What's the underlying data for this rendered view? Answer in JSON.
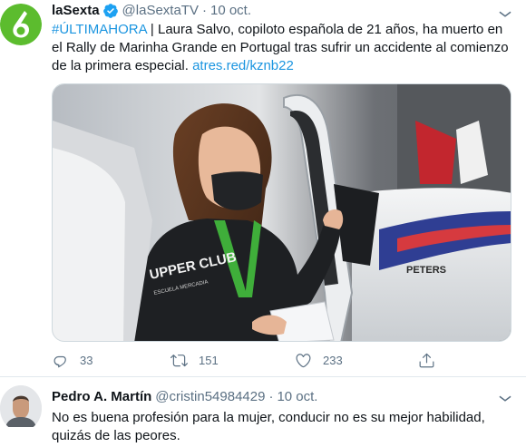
{
  "main_tweet": {
    "author_name": "laSexta",
    "author_handle": "@laSextaTV",
    "separator": "·",
    "date": "10 oct.",
    "hashtag": "#ÚLTIMAHORA",
    "body": " | Laura Salvo, copiloto española de 21 años, ha muerto en el Rally de Marinha Grande en Portugal tras sufrir un accidente al comienzo de la primera especial. ",
    "link": "atres.red/kznb22",
    "media": {
      "car_lettering": "PETERS",
      "sticker_text": "UPPER CLUB",
      "sticker_subtext": "ESCUELA MERCADIA"
    },
    "actions": {
      "replies": "33",
      "retweets": "151",
      "likes": "233"
    }
  },
  "reply_tweet": {
    "author_name": "Pedro A. Martín",
    "author_handle": "@cristin54984429",
    "separator": "·",
    "date": "10 oct.",
    "body": "No es buena profesión para la mujer, conducir no es su mejor habilidad, quizás de las peores."
  },
  "colors": {
    "brand_green": "#5cbc2e",
    "link_blue": "#1b95e0",
    "secondary_text": "#5b7083",
    "divider": "#e1e8ed"
  },
  "icons": [
    "lasexta-logo-icon",
    "verified-badge-icon",
    "more-options-icon",
    "reply-icon",
    "retweet-icon",
    "like-icon",
    "share-icon"
  ]
}
